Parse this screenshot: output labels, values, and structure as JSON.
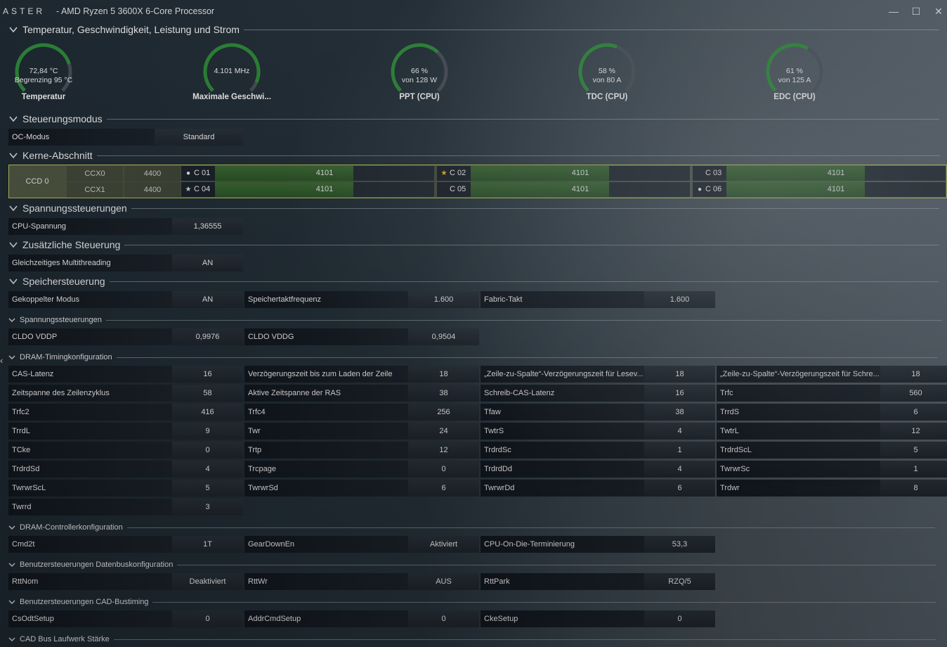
{
  "window": {
    "brand": "ASTER",
    "title": "-  AMD Ryzen 5 3600X 6-Core Processor",
    "min": "—",
    "max": "☐",
    "close": "✕"
  },
  "colors": {
    "gauge_fill": "#2f8a3a",
    "gauge_track": "#4a5058",
    "core_fill": "#2f5a2a",
    "accent": "#b8c25a"
  },
  "sections": {
    "temp": "Temperatur, Geschwindigkeit, Leistung und Strom",
    "mode": "Steuerungsmodus",
    "cores": "Kerne-Abschnitt",
    "voltage": "Spannungssteuerungen",
    "extra": "Zusätzliche Steuerung",
    "memory": "Speichersteuerung",
    "subvolt": "Spannungssteuerungen",
    "dram_timing": "DRAM-Timingkonfiguration",
    "dram_ctrl": "DRAM-Controllerkonfiguration",
    "databus": "Benutzersteuerungen Datenbuskonfiguration",
    "cad": "Benutzersteuerungen CAD-Bustiming",
    "cadstr": "CAD Bus Laufwerk Stärke"
  },
  "gauges": [
    {
      "line1": "72,84 °C",
      "line2": "Begrenzing  95 °C",
      "label": "Temperatur",
      "fraction": 0.77
    },
    {
      "line1": "4.101  MHz",
      "line2": "",
      "label": "Maximale Geschwi...",
      "fraction": 0.92
    },
    {
      "line1": "66 %",
      "line2": "von  128 W",
      "label": "PPT (CPU)",
      "fraction": 0.66
    },
    {
      "line1": "58 %",
      "line2": "von  80 A",
      "label": "TDC (CPU)",
      "fraction": 0.58
    },
    {
      "line1": "61 %",
      "line2": "von  125 A",
      "label": "EDC (CPU)",
      "fraction": 0.61
    }
  ],
  "oc": {
    "key": "OC-Modus",
    "val": "Standard"
  },
  "ccd": {
    "name": "CCD 0",
    "ccx": [
      {
        "name": "CCX0",
        "val": "4400"
      },
      {
        "name": "CCX1",
        "val": "4400"
      }
    ],
    "cores": [
      {
        "name": "C 01",
        "mark": "dot",
        "val": "4101",
        "fraction": 0.63
      },
      {
        "name": "C 02",
        "mark": "gold-star",
        "val": "4101",
        "fraction": 0.63
      },
      {
        "name": "C 03",
        "mark": "",
        "val": "4101",
        "fraction": 0.63
      },
      {
        "name": "C 04",
        "mark": "star",
        "val": "4101",
        "fraction": 0.63
      },
      {
        "name": "C 05",
        "mark": "",
        "val": "4101",
        "fraction": 0.63
      },
      {
        "name": "C 06",
        "mark": "dot",
        "val": "4101",
        "fraction": 0.63
      }
    ]
  },
  "cpu_voltage": {
    "key": "CPU-Spannung",
    "val": "1,36555"
  },
  "smt": {
    "key": "Gleichzeitiges Multithreading",
    "val": "AN"
  },
  "memory": [
    {
      "key": "Gekoppelter Modus",
      "val": "AN"
    },
    {
      "key": "Speichertaktfrequenz",
      "val": "1.600"
    },
    {
      "key": "Fabric-Takt",
      "val": "1.600"
    }
  ],
  "volt": [
    {
      "key": "CLDO VDDP",
      "val": "0,9976"
    },
    {
      "key": "CLDO VDDG",
      "val": "0,9504"
    }
  ],
  "timings": [
    {
      "key": "CAS-Latenz",
      "val": "16"
    },
    {
      "key": "Verzögerungszeit bis zum Laden der Zeile",
      "val": "18"
    },
    {
      "key": "„Zeile-zu-Spalte“-Verzögerungszeit für Lesev...",
      "val": "18"
    },
    {
      "key": "„Zeile-zu-Spalte“-Verzögerungszeit für Schre...",
      "val": "18"
    },
    {
      "key": "Zeitspanne des Zeilenzyklus",
      "val": "58"
    },
    {
      "key": "Aktive Zeitspanne der RAS",
      "val": "38"
    },
    {
      "key": "Schreib-CAS-Latenz",
      "val": "16"
    },
    {
      "key": "Trfc",
      "val": "560"
    },
    {
      "key": "Trfc2",
      "val": "416"
    },
    {
      "key": "Trfc4",
      "val": "256"
    },
    {
      "key": "Tfaw",
      "val": "38"
    },
    {
      "key": "TrrdS",
      "val": "6"
    },
    {
      "key": "TrrdL",
      "val": "9"
    },
    {
      "key": "Twr",
      "val": "24"
    },
    {
      "key": "TwtrS",
      "val": "4"
    },
    {
      "key": "TwtrL",
      "val": "12"
    },
    {
      "key": "TCke",
      "val": "0"
    },
    {
      "key": "Trtp",
      "val": "12"
    },
    {
      "key": "TrdrdSc",
      "val": "1"
    },
    {
      "key": "TrdrdScL",
      "val": "5"
    },
    {
      "key": "TrdrdSd",
      "val": "4"
    },
    {
      "key": "Trcpage",
      "val": "0"
    },
    {
      "key": "TrdrdDd",
      "val": "4"
    },
    {
      "key": "TwrwrSc",
      "val": "1"
    },
    {
      "key": "TwrwrScL",
      "val": "5"
    },
    {
      "key": "TwrwrSd",
      "val": "6"
    },
    {
      "key": "TwrwrDd",
      "val": "6"
    },
    {
      "key": "Trdwr",
      "val": "8"
    },
    {
      "key": "Twrrd",
      "val": "3"
    }
  ],
  "ctrl": [
    {
      "key": "Cmd2t",
      "val": "1T"
    },
    {
      "key": "GearDownEn",
      "val": "Aktiviert"
    },
    {
      "key": "CPU-On-Die-Terminierung",
      "val": "53,3"
    }
  ],
  "databus": [
    {
      "key": "RttNom",
      "val": "Deaktiviert"
    },
    {
      "key": "RttWr",
      "val": "AUS"
    },
    {
      "key": "RttPark",
      "val": "RZQ/5"
    }
  ],
  "cad": [
    {
      "key": "CsOdtSetup",
      "val": "0"
    },
    {
      "key": "AddrCmdSetup",
      "val": "0"
    },
    {
      "key": "CkeSetup",
      "val": "0"
    }
  ],
  "left_arrow": "‹"
}
